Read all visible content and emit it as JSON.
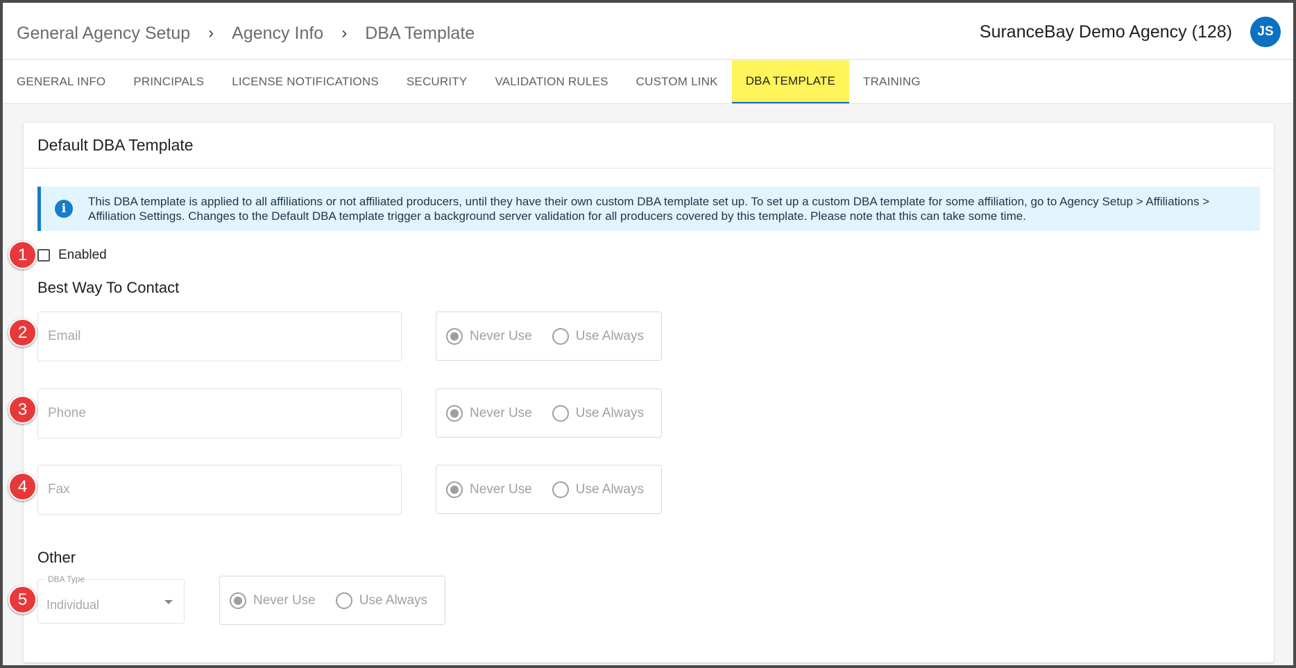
{
  "breadcrumb": {
    "items": [
      "General Agency Setup",
      "Agency Info",
      "DBA Template"
    ],
    "separator": "›"
  },
  "header": {
    "agency_name": "SuranceBay Demo Agency (128)",
    "avatar_initials": "JS"
  },
  "tabs": [
    {
      "label": "GENERAL INFO",
      "active": false
    },
    {
      "label": "PRINCIPALS",
      "active": false
    },
    {
      "label": "LICENSE NOTIFICATIONS",
      "active": false
    },
    {
      "label": "SECURITY",
      "active": false
    },
    {
      "label": "VALIDATION RULES",
      "active": false
    },
    {
      "label": "CUSTOM LINK",
      "active": false
    },
    {
      "label": "DBA TEMPLATE",
      "active": true
    },
    {
      "label": "TRAINING",
      "active": false
    }
  ],
  "card": {
    "title": "Default DBA Template",
    "info_text": "This DBA template is applied to all affiliations or not affiliated producers, until they have their own custom DBA template set up. To set up a custom DBA template for some affiliation, go to Agency Setup > Affiliations > Affiliation Settings. Changes to the Default DBA template trigger a background server validation for all producers covered by this template. Please note that this can take some time.",
    "enabled": {
      "label": "Enabled",
      "checked": false
    },
    "best_way_title": "Best Way To Contact",
    "contact_fields": [
      {
        "placeholder": "Email",
        "never_use": "Never Use",
        "use_always": "Use Always",
        "selected": "never"
      },
      {
        "placeholder": "Phone",
        "never_use": "Never Use",
        "use_always": "Use Always",
        "selected": "never"
      },
      {
        "placeholder": "Fax",
        "never_use": "Never Use",
        "use_always": "Use Always",
        "selected": "never"
      }
    ],
    "other_title": "Other",
    "dba_type": {
      "label": "DBA Type",
      "value": "Individual",
      "never_use": "Never Use",
      "use_always": "Use Always",
      "selected": "never"
    }
  },
  "annotations": [
    "1",
    "2",
    "3",
    "4",
    "5"
  ],
  "colors": {
    "accent": "#1a7cc6",
    "active_tab_bg": "#fff45a",
    "badge": "#e8393a",
    "avatar": "#0a72c0"
  }
}
